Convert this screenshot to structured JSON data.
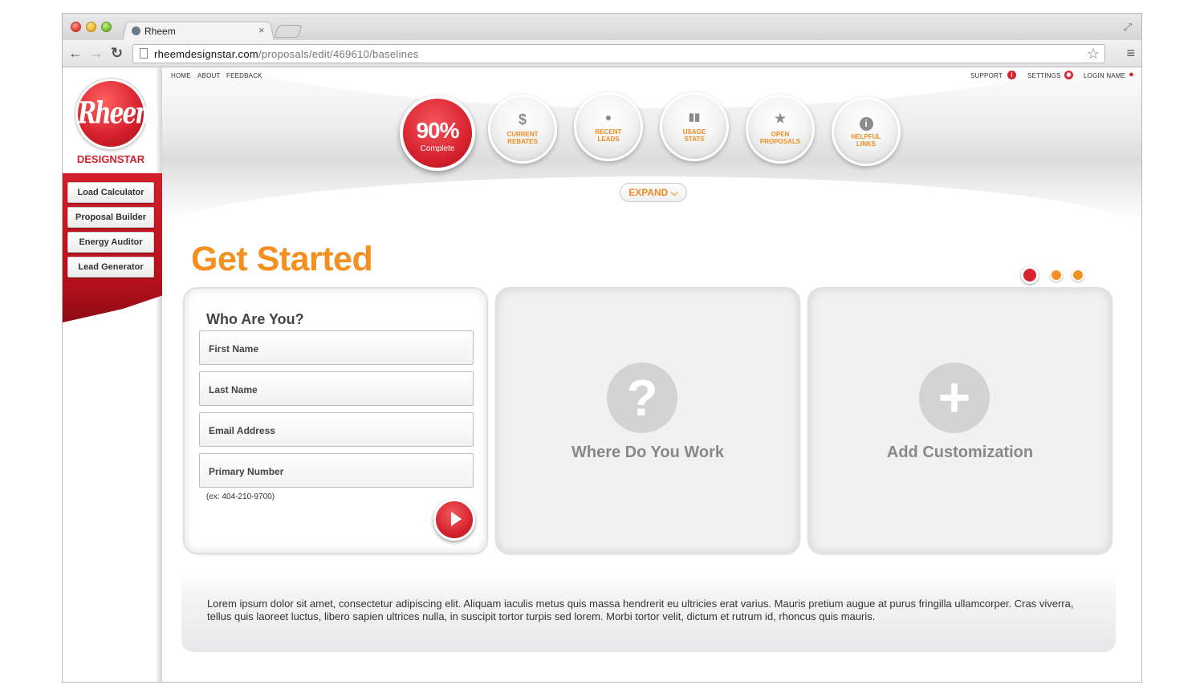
{
  "browser": {
    "tab_title": "Rheem",
    "url_host": "rheemdesignstar.com",
    "url_path": "/proposals/edit/469610/baselines"
  },
  "brand": {
    "logo_text": "Rheem",
    "name": "DESIGNSTAR",
    "primary_color": "#d7232f",
    "accent_color": "#f39020"
  },
  "sidebar": {
    "items": [
      {
        "label": "Load Calculator"
      },
      {
        "label": "Proposal Builder"
      },
      {
        "label": "Energy Auditor"
      },
      {
        "label": "Lead Generator"
      }
    ]
  },
  "top_nav": {
    "left": [
      "HOME",
      "ABOUT",
      "FEEDBACK"
    ],
    "support": "SUPPORT",
    "settings": "SETTINGS",
    "login": "LOGIN NAME"
  },
  "progress": {
    "value": "90%",
    "label": "Complete"
  },
  "quick_links": [
    {
      "icon": "dollar-icon",
      "glyph": "$",
      "label_1": "CURRENT",
      "label_2": "REBATES"
    },
    {
      "icon": "person-icon",
      "glyph": "●",
      "label_1": "RECENT",
      "label_2": "LEADS"
    },
    {
      "icon": "bar-chart-icon",
      "glyph": "▮▮",
      "label_1": "USAGE",
      "label_2": "STATS"
    },
    {
      "icon": "star-icon",
      "glyph": "★",
      "label_1": "OPEN",
      "label_2": "PROPOSALS"
    },
    {
      "icon": "info-icon",
      "glyph": "i",
      "label_1": "HELPFUL",
      "label_2": "LINKS"
    }
  ],
  "expand_label": "EXPAND",
  "main": {
    "title": "Get Started",
    "steps": 3,
    "active_step": 1
  },
  "who_card": {
    "title": "Who Are You?",
    "fields": [
      {
        "label": "First Name"
      },
      {
        "label": "Last Name"
      },
      {
        "label": "Email Address"
      },
      {
        "label": "Primary Number"
      }
    ],
    "hint": "(ex: 404-210-9700)"
  },
  "work_card": {
    "title": "Where Do You Work",
    "icon": "question-icon"
  },
  "custom_card": {
    "title": "Add Customization",
    "icon": "plus-icon"
  },
  "footer_text": "Lorem ipsum dolor sit amet, consectetur adipiscing elit. Aliquam iaculis metus quis massa hendrerit eu ultricies erat varius. Mauris pretium augue at purus fringilla ullamcorper. Cras viverra, tellus quis laoreet luctus, libero sapien ultrices nulla, in suscipit tortor turpis sed lorem. Morbi tortor velit, dictum et rutrum id, rhoncus quis mauris."
}
